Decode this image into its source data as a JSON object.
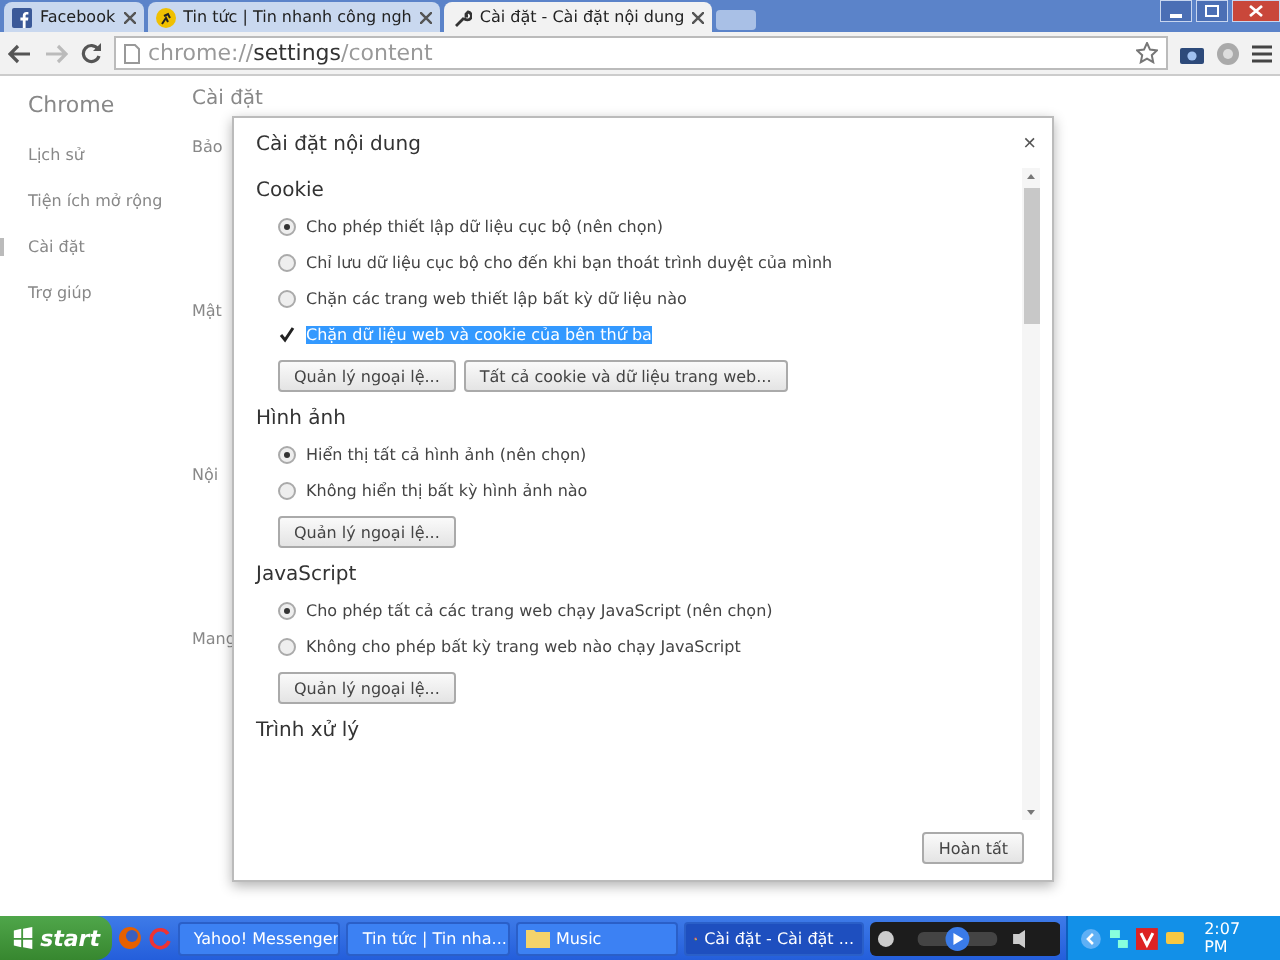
{
  "tabs": [
    {
      "title": "Facebook",
      "selected": false
    },
    {
      "title": "Tin tức | Tin nhanh công ngh",
      "selected": false
    },
    {
      "title": "Cài đặt - Cài đặt nội dung",
      "selected": true
    }
  ],
  "address": {
    "scheme": "chrome://",
    "host": "settings",
    "path": "/content"
  },
  "page": {
    "brand": "Chrome",
    "nav": [
      {
        "label": "Lịch sử",
        "selected": false
      },
      {
        "label": "Tiện ích mở rộng",
        "selected": false
      },
      {
        "label": "Cài đặt",
        "selected": true
      },
      {
        "label": "Trợ giúp",
        "selected": false
      }
    ],
    "heading": "Cài đặt",
    "sections": [
      "Bảo",
      "Mật",
      "Nội",
      "Mang"
    ]
  },
  "dialog": {
    "title": "Cài đặt nội dung",
    "close": "×",
    "groups": [
      {
        "title": "Cookie",
        "options": [
          {
            "kind": "radio",
            "label": "Cho phép thiết lập dữ liệu cục bộ (nên chọn)",
            "selected": true
          },
          {
            "kind": "radio",
            "label": "Chỉ lưu dữ liệu cục bộ cho đến khi bạn thoát trình duyệt của mình",
            "selected": false
          },
          {
            "kind": "radio",
            "label": "Chặn các trang web thiết lập bất kỳ dữ liệu nào",
            "selected": false
          },
          {
            "kind": "checkbox",
            "label": "Chặn dữ liệu web và cookie của bên thứ ba",
            "checked": true,
            "highlighted": true
          }
        ],
        "buttons": [
          "Quản lý ngoại lệ...",
          "Tất cả cookie và dữ liệu trang web..."
        ]
      },
      {
        "title": "Hình ảnh",
        "options": [
          {
            "kind": "radio",
            "label": "Hiển thị tất cả hình ảnh (nên chọn)",
            "selected": true
          },
          {
            "kind": "radio",
            "label": "Không hiển thị bất kỳ hình ảnh nào",
            "selected": false
          }
        ],
        "buttons": [
          "Quản lý ngoại lệ..."
        ]
      },
      {
        "title": "JavaScript",
        "options": [
          {
            "kind": "radio",
            "label": "Cho phép tất cả các trang web chạy JavaScript (nên chọn)",
            "selected": true
          },
          {
            "kind": "radio",
            "label": "Không cho phép bất kỳ trang web nào chạy JavaScript",
            "selected": false
          }
        ],
        "buttons": [
          "Quản lý ngoại lệ..."
        ]
      },
      {
        "title": "Trình xử lý"
      }
    ],
    "done": "Hoàn tất"
  },
  "taskbar": {
    "start": "start",
    "items": [
      {
        "label": "Yahoo! Messenger",
        "selected": false
      },
      {
        "label": "Tin tức | Tin nha...",
        "selected": false
      },
      {
        "label": "Music",
        "selected": false
      },
      {
        "label": "Cài đặt - Cài đặt ...",
        "selected": true
      }
    ],
    "clock": "2:07 PM"
  }
}
